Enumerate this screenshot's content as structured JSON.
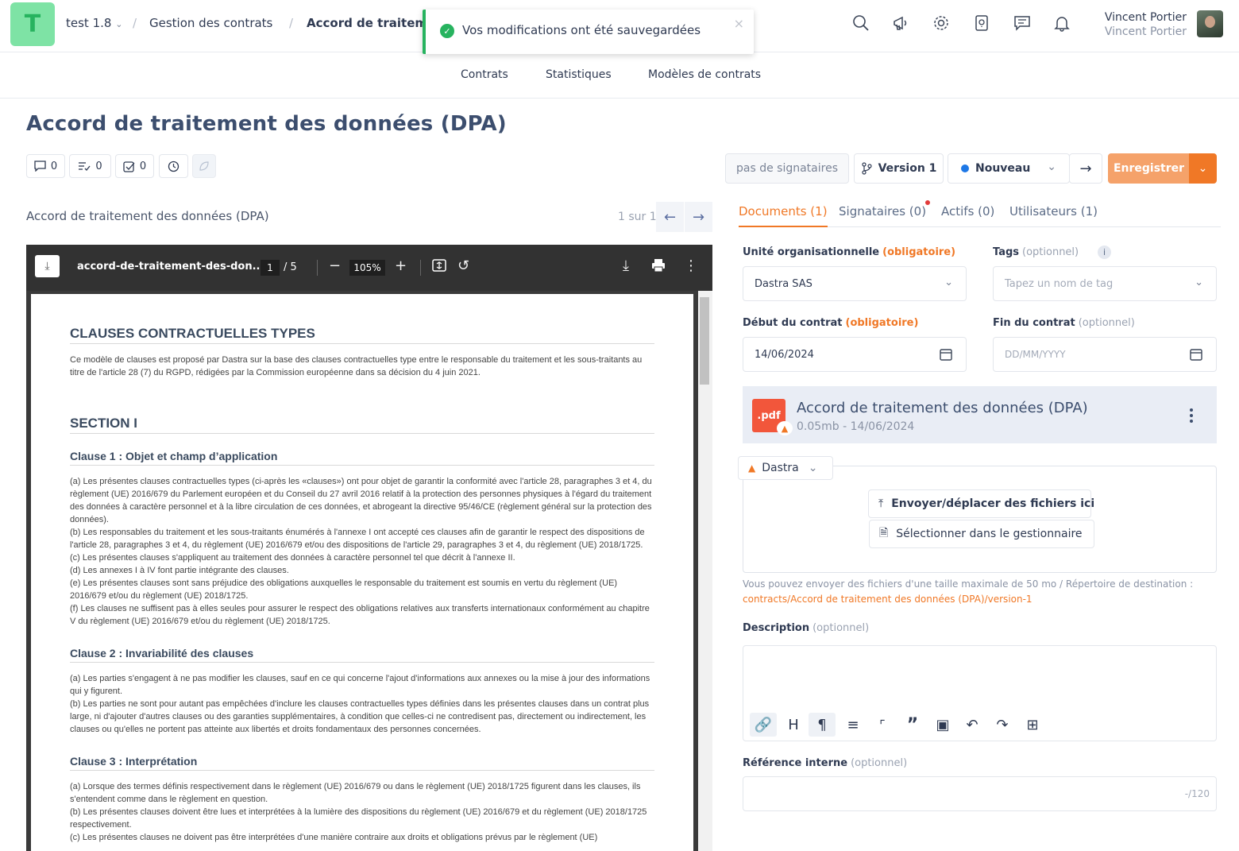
{
  "header": {
    "logo_letter": "T",
    "workspace": "test 1.8",
    "breadcrumb": [
      "Gestion des contrats",
      "Accord de traiteme"
    ],
    "user_name": "Vincent Portier",
    "user_sub": "Vincent Portier",
    "icons": [
      "search-icon",
      "megaphone-icon",
      "gear-icon",
      "help-icon",
      "chat-icon",
      "bell-icon"
    ]
  },
  "toast": {
    "message": "Vos modifications ont été sauvegardées"
  },
  "subnav": {
    "items": [
      "Contrats",
      "Statistiques",
      "Modèles de contrats"
    ]
  },
  "page": {
    "title": "Accord de traitement des données (DPA)",
    "counters": {
      "comments": "0",
      "tasks": "0",
      "checks": "0"
    }
  },
  "viewer": {
    "doc_label": "Accord de traitement des données (DPA)",
    "pager": "1 sur 1",
    "file_name": "accord-de-traitement-des-don...",
    "page_current": "1",
    "page_total": "/ 5",
    "zoom": "105%",
    "content": {
      "h_main": "CLAUSES CONTRACTUELLES TYPES",
      "intro": "Ce modèle de clauses est proposé par Dastra sur la base des clauses contractuelles type entre le responsable du traitement et les sous-traitants au titre de l'article 28 (7) du RGPD, rédigées par la Commission européenne dans sa décision du 4 juin 2021.",
      "h_section": "SECTION I",
      "c1_title": "Clause 1 : Objet et champ d’application",
      "c1_text": [
        "(a) Les présentes clauses contractuelles types (ci-après les «clauses») ont pour objet de garantir la conformité avec l'article 28, paragraphes 3 et 4, du règlement (UE) 2016/679 du Parlement européen et du Conseil du 27 avril 2016 relatif à la protection des personnes physiques à l'égard du traitement des données à caractère personnel et à la libre circulation de ces données, et abrogeant la directive 95/46/CE (règlement général sur la protection des données).",
        "(b) Les responsables du traitement et les sous-traitants énumérés à l'annexe I ont accepté ces clauses afin de garantir le respect des dispositions de l'article 28, paragraphes 3 et 4, du règlement (UE) 2016/679 et/ou des dispositions de l'article 29, paragraphes 3 et 4, du règlement (UE) 2018/1725.",
        "(c) Les présentes clauses s'appliquent au traitement des données à caractère personnel tel que décrit à l'annexe II.",
        "(d) Les annexes I à IV font partie intégrante des clauses.",
        "(e) Les présentes clauses sont sans préjudice des obligations auxquelles le responsable du traitement est soumis en vertu du règlement (UE) 2016/679 et/ou du règlement (UE) 2018/1725.",
        "(f) Les clauses ne suffisent pas à elles seules pour assurer le respect des obligations relatives aux transferts internationaux conformément au chapitre V du règlement (UE) 2016/679 et/ou du règlement (UE) 2018/1725."
      ],
      "c2_title": "Clause 2 : Invariabilité des clauses",
      "c2_text": [
        "(a) Les parties s'engagent à ne pas modifier les clauses, sauf en ce qui concerne l'ajout d'informations aux annexes ou la mise à jour des informations qui y figurent.",
        "(b) Les parties ne sont pour autant pas empêchées d'inclure les clauses contractuelles types définies dans les présentes clauses dans un contrat plus large, ni d'ajouter d'autres clauses ou des garanties supplémentaires, à condition que celles-ci ne contredisent pas, directement ou indirectement, les clauses ou qu'elles ne portent pas atteinte aux libertés et droits fondamentaux des personnes concernées."
      ],
      "c3_title": "Clause 3 : Interprétation",
      "c3_text": [
        "(a) Lorsque des termes définis respectivement dans le règlement (UE) 2016/679 ou dans le règlement (UE) 2018/1725 figurent dans les clauses, ils s'entendent comme dans le règlement en question.",
        "(b) Les présentes clauses doivent être lues et interprétées à la lumière des dispositions du règlement (UE) 2016/679 et du règlement (UE) 2018/1725 respectivement.",
        "(c) Les présentes clauses ne doivent pas être interprétées d'une manière contraire aux droits et obligations prévus par le règlement (UE)"
      ]
    }
  },
  "right": {
    "signers_btn": "pas de signataires",
    "version_btn": "Version 1",
    "status": "Nouveau",
    "save_btn": "Enregistrer",
    "accent": "#f07826",
    "tabs": [
      "Documents (1)",
      "Signataires (0)",
      "Actifs (0)",
      "Utilisateurs (1)"
    ],
    "org_label": "Unité organisationnelle",
    "required": "(obligatoire)",
    "optional": "(optionnel)",
    "org_value": "Dastra SAS",
    "tags_label": "Tags",
    "tags_placeholder": "Tapez un nom de tag",
    "start_label": "Début du contrat",
    "start_value": "14/06/2024",
    "end_label": "Fin du contrat",
    "end_placeholder": "DD/MM/YYYY",
    "file_title": "Accord de traitement des données (DPA)",
    "file_meta": "0.05mb - 14/06/2024",
    "file_ext": ".pdf",
    "source": "Dastra",
    "upload_btn": "Envoyer/déplacer des fichiers ici",
    "select_btn": "Sélectionner dans le gestionnaire",
    "hint": "Vous pouvez envoyer des fichiers d'une taille maximale de 50 mo / Répertoire de destination :",
    "hint_path": "contracts/Accord de traitement des données (DPA)/version-1",
    "desc_label": "Description",
    "ref_label": "Référence interne",
    "ref_counter": "-/120"
  }
}
